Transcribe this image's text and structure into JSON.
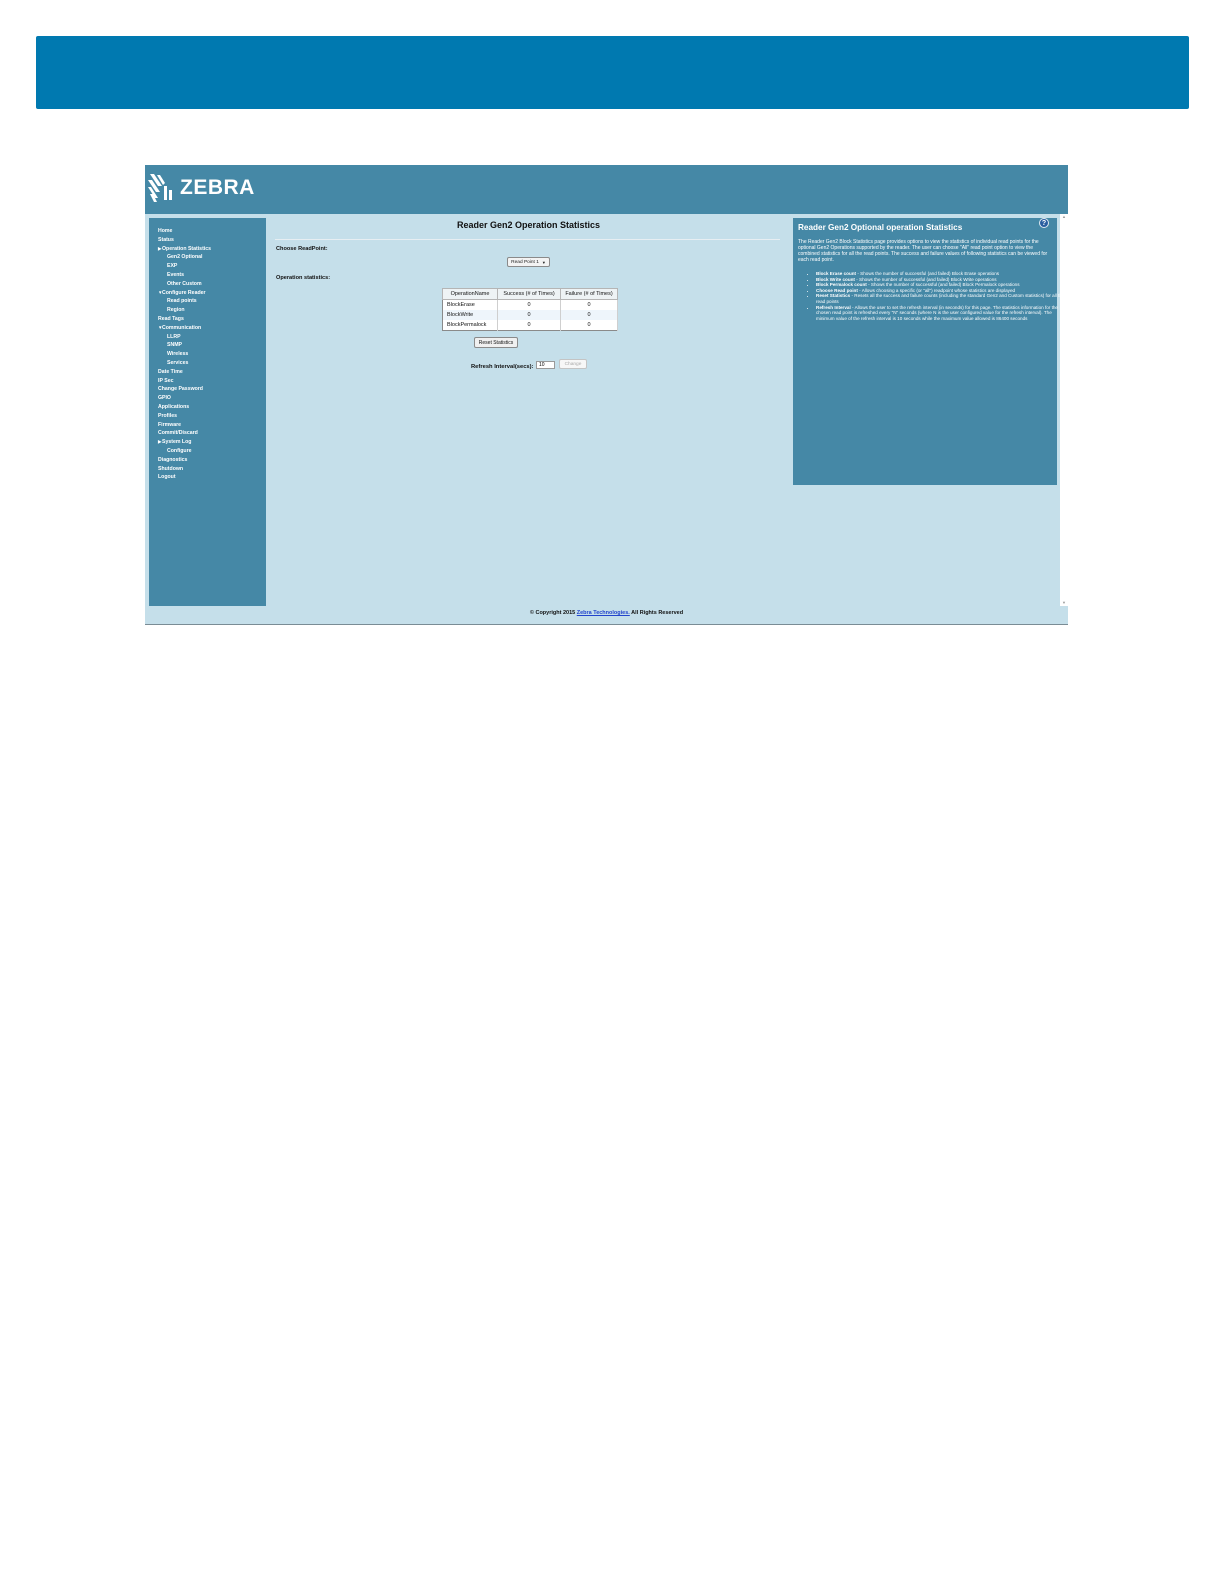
{
  "brand": {
    "name": "ZEBRA"
  },
  "sidebar": {
    "items": [
      {
        "label": "Home",
        "level": 0,
        "arrow": ""
      },
      {
        "label": "Status",
        "level": 0,
        "arrow": ""
      },
      {
        "label": "Operation Statistics",
        "level": 0,
        "arrow": "right"
      },
      {
        "label": "Gen2 Optional",
        "level": 1,
        "arrow": ""
      },
      {
        "label": "EXP",
        "level": 1,
        "arrow": ""
      },
      {
        "label": "Events",
        "level": 1,
        "arrow": ""
      },
      {
        "label": "Other Custom",
        "level": 1,
        "arrow": ""
      },
      {
        "label": "Configure Reader",
        "level": 0,
        "arrow": "down"
      },
      {
        "label": "Read points",
        "level": 1,
        "arrow": ""
      },
      {
        "label": "Region",
        "level": 1,
        "arrow": ""
      },
      {
        "label": "Read Tags",
        "level": 0,
        "arrow": ""
      },
      {
        "label": "Communication",
        "level": 0,
        "arrow": "down"
      },
      {
        "label": "LLRP",
        "level": 1,
        "arrow": ""
      },
      {
        "label": "SNMP",
        "level": 1,
        "arrow": ""
      },
      {
        "label": "Wireless",
        "level": 1,
        "arrow": ""
      },
      {
        "label": "Services",
        "level": 1,
        "arrow": ""
      },
      {
        "label": "Date Time",
        "level": 0,
        "arrow": ""
      },
      {
        "label": "IP Sec",
        "level": 0,
        "arrow": ""
      },
      {
        "label": "Change Password",
        "level": 0,
        "arrow": ""
      },
      {
        "label": "GPIO",
        "level": 0,
        "arrow": ""
      },
      {
        "label": "Applications",
        "level": 0,
        "arrow": ""
      },
      {
        "label": "Profiles",
        "level": 0,
        "arrow": ""
      },
      {
        "label": "Firmware",
        "level": 0,
        "arrow": ""
      },
      {
        "label": "Commit/Discard",
        "level": 0,
        "arrow": ""
      },
      {
        "label": "System Log",
        "level": 0,
        "arrow": "right"
      },
      {
        "label": "Configure",
        "level": 1,
        "arrow": ""
      },
      {
        "label": "Diagnostics",
        "level": 0,
        "arrow": ""
      },
      {
        "label": "Shutdown",
        "level": 0,
        "arrow": ""
      },
      {
        "label": "Logout",
        "level": 0,
        "arrow": ""
      }
    ]
  },
  "main": {
    "title": "Reader Gen2 Operation Statistics",
    "choose_label": "Choose ReadPoint:",
    "readpoint_select": "Read Point 1",
    "stats_label": "Operation statistics:",
    "table": {
      "headers": [
        "OperationName",
        "Success (# of Times)",
        "Failure (# of Times)"
      ],
      "rows": [
        [
          "BlockErase",
          "0",
          "0"
        ],
        [
          "BlockWrite",
          "0",
          "0"
        ],
        [
          "BlockPermalock",
          "0",
          "0"
        ]
      ]
    },
    "reset_button": "Reset Statistics",
    "refresh_label": "Refresh Interval(secs):",
    "refresh_value": "10",
    "change_button": "Change"
  },
  "help": {
    "title": "Reader Gen2 Optional operation Statistics",
    "icon_text": "?",
    "intro": "The Reader Gen2 Block Statistics page provides options to view the statistics of individual read points for the optional Gen2 Operations supported by the reader. The user can choose \"All\" read point option to view the combined statistics for all the read points. The success and failure values of following statistics can be viewed for each read point.",
    "items": [
      {
        "term": "Block Erase count",
        "desc": " - Shows the number of successful (and failed) Block Erase operations"
      },
      {
        "term": "Block Write count",
        "desc": " - Shows the number of successful (and failed) Block Write operations"
      },
      {
        "term": "Block Permalock count",
        "desc": " - Shows the number of successful (and failed) Block Permalock operations"
      },
      {
        "term": "Choose Read point",
        "desc": " - Allows choosing a specific (or \"all\") readpoint whose statistics are displayed"
      },
      {
        "term": "Reset Statistics",
        "desc": " - Resets all the success and failure counts (including the standard Gen2 and Custom statistics) for all the read points"
      },
      {
        "term": "Refresh Interval",
        "desc": " - Allows the user to set the refresh interval (in seconds) for this page. The statistics information for the chosen read point is refreshed every \"N\" seconds (where N is the user configured value for the refresh interval). The minimum value of the refresh interval is 10 seconds while the maximum value allowed is 86400 seconds"
      }
    ]
  },
  "footer": {
    "prefix": "© Copyright 2015 ",
    "link": "Zebra Technologies.",
    "suffix": " All Rights Reserved"
  },
  "colors": {
    "banner": "#0079b0",
    "panel": "#4588a6",
    "background": "#c5dfea"
  }
}
